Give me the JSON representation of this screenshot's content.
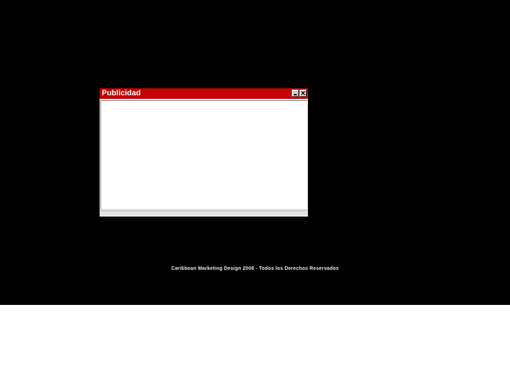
{
  "popup": {
    "title": "Publicidad",
    "close_glyph": "✕"
  },
  "footer": {
    "text": "Caribbean Marketing Design 2008 - Todos los Derechos Reservados"
  },
  "colors": {
    "background": "#000000",
    "titlebar": "#c60000",
    "page_below": "#ffffff"
  },
  "icons": [
    "minimize-icon",
    "close-icon"
  ]
}
